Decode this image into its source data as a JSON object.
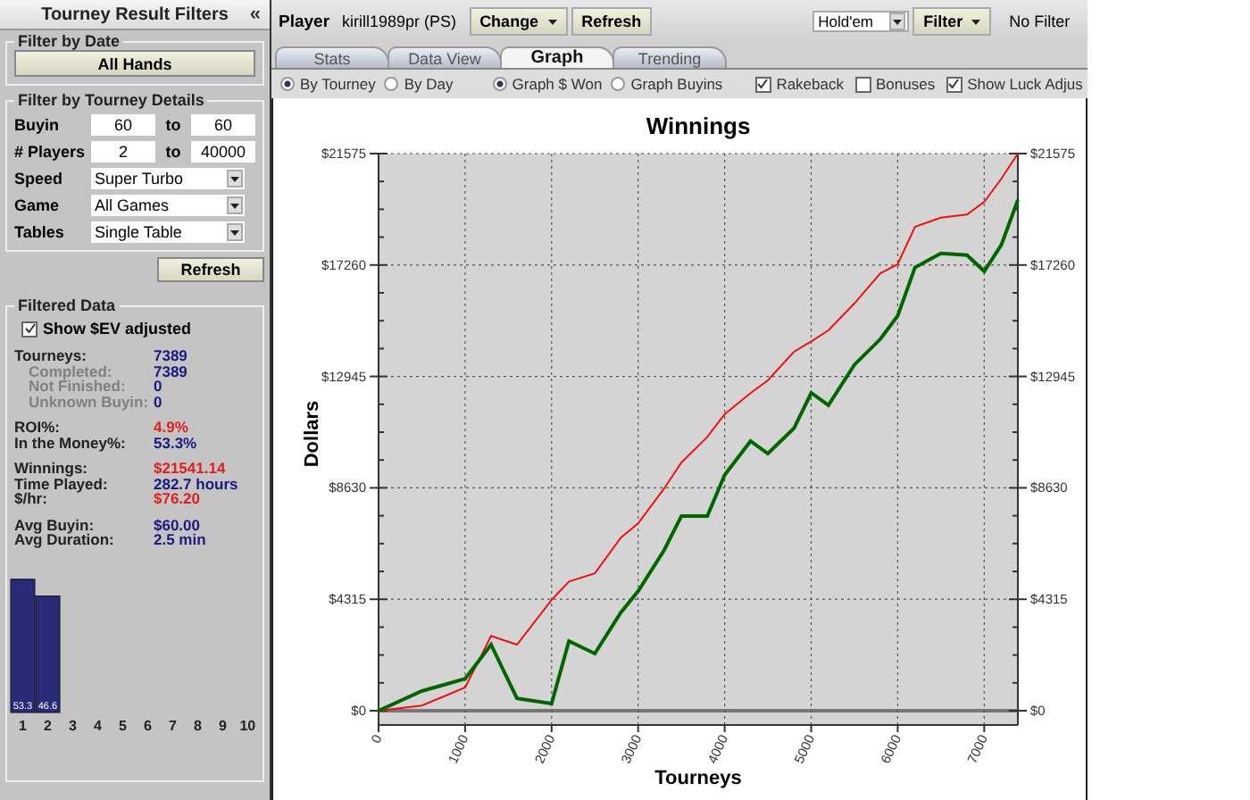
{
  "sidebar": {
    "title": "Tourney Result Filters",
    "collapse_glyph": "«",
    "date_filter": {
      "legend": "Filter by Date",
      "button": "All Hands"
    },
    "details": {
      "legend": "Filter by Tourney Details",
      "ranges": [
        {
          "label": "Buyin",
          "from": "60",
          "sep": "to",
          "to": "60"
        },
        {
          "label": "# Players",
          "from": "2",
          "sep": "to",
          "to": "40000"
        }
      ],
      "selects": [
        {
          "label": "Speed",
          "value": "Super Turbo"
        },
        {
          "label": "Game",
          "value": "All Games"
        },
        {
          "label": "Tables",
          "value": "Single Table"
        }
      ],
      "refresh": "Refresh"
    },
    "filtered": {
      "legend": "Filtered Data",
      "ev_checkbox": {
        "label": "Show $EV adjusted",
        "checked": true
      },
      "groups": [
        [
          {
            "label": "Tourneys:",
            "value": "7389",
            "sub": false,
            "color": "#1a1a80"
          },
          {
            "label": "Completed:",
            "value": "7389",
            "sub": true,
            "color": "#1a1a80"
          },
          {
            "label": "Not Finished:",
            "value": "0",
            "sub": true,
            "color": "#1a1a80"
          },
          {
            "label": "Unknown Buyin:",
            "value": "0",
            "sub": true,
            "color": "#1a1a80"
          }
        ],
        [
          {
            "label": "ROI%:",
            "value": "4.9%",
            "sub": false,
            "color": "#e02020"
          },
          {
            "label": "In the Money%:",
            "value": "53.3%",
            "sub": false,
            "color": "#1a1a80"
          }
        ],
        [
          {
            "label": "Winnings:",
            "value": "$21541.14",
            "sub": false,
            "color": "#e02020"
          },
          {
            "label": "Time Played:",
            "value": "282.7 hours",
            "sub": false,
            "color": "#1a1a80"
          },
          {
            "label": "$/hr:",
            "value": "$76.20",
            "sub": false,
            "color": "#e02020"
          }
        ],
        [
          {
            "label": "Avg Buyin:",
            "value": "$60.00",
            "sub": false,
            "color": "#1a1a80"
          },
          {
            "label": "Avg Duration:",
            "value": "2.5 min",
            "sub": false,
            "color": "#1a1a80"
          }
        ]
      ],
      "histogram": {
        "chart_data": {
          "type": "bar",
          "categories": [
            "1",
            "2",
            "3",
            "4",
            "5",
            "6",
            "7",
            "8",
            "9",
            "10"
          ],
          "values": [
            53.3,
            46.6,
            0,
            0,
            0,
            0,
            0,
            0,
            0,
            0
          ],
          "data_labels": true,
          "value_labels": [
            "53.3",
            "46.6",
            null,
            null,
            null,
            null,
            null,
            null,
            null,
            null
          ]
        }
      }
    }
  },
  "toolbar": {
    "player_label": "Player",
    "player": "kirill1989pr (PS)",
    "buttons": [
      {
        "label": "Change",
        "dropdown": true
      },
      {
        "label": "Refresh",
        "dropdown": false
      }
    ],
    "game_select": "Hold'em",
    "filter_button": {
      "label": "Filter",
      "dropdown": true
    },
    "filter_status": "No Filter"
  },
  "tabs": [
    {
      "label": "Stats",
      "selected": false
    },
    {
      "label": "Data View",
      "selected": false
    },
    {
      "label": "Graph",
      "selected": true
    },
    {
      "label": "Trending",
      "selected": false
    }
  ],
  "options": {
    "radio_groups": [
      [
        {
          "label": "By Tourney",
          "selected": true
        },
        {
          "label": "By Day",
          "selected": false
        }
      ],
      [
        {
          "label": "Graph $ Won",
          "selected": true
        },
        {
          "label": "Graph Buyins",
          "selected": false
        }
      ]
    ],
    "checkboxes": [
      {
        "label": "Rakeback",
        "checked": true
      },
      {
        "label": "Bonuses",
        "checked": false
      },
      {
        "label": "Show Luck Adjus",
        "checked": true
      }
    ]
  },
  "chart": {
    "chart_data": {
      "type": "line",
      "title": "Winnings",
      "xlabel": "Tourneys",
      "ylabel": "Dollars",
      "x": [
        0,
        500,
        1000,
        1300,
        1600,
        2000,
        2200,
        2500,
        2800,
        3000,
        3300,
        3500,
        3800,
        4000,
        4300,
        4500,
        4800,
        5000,
        5200,
        5500,
        5800,
        6000,
        6200,
        6500,
        6800,
        7000,
        7200,
        7389
      ],
      "series": [
        {
          "color": "#ee1111",
          "values": [
            0,
            200,
            900,
            2900,
            2560,
            4290,
            5000,
            5320,
            6700,
            7260,
            8600,
            9610,
            10600,
            11480,
            12300,
            12790,
            13900,
            14300,
            14730,
            15770,
            16940,
            17290,
            18740,
            19090,
            19220,
            19710,
            20610,
            21575
          ]
        },
        {
          "color": "#006600",
          "values": [
            0,
            760,
            1240,
            2560,
            480,
            280,
            2700,
            2210,
            3800,
            4630,
            6220,
            7540,
            7540,
            9130,
            10440,
            9960,
            10930,
            12310,
            11830,
            13400,
            14390,
            15290,
            17160,
            17710,
            17640,
            17020,
            18050,
            19780
          ]
        }
      ],
      "xlim": [
        0,
        7389
      ],
      "ylim": [
        0,
        21575
      ],
      "grid": true,
      "xticks": [
        {
          "value": 0,
          "label": "0"
        },
        {
          "value": 1000,
          "label": "1000"
        },
        {
          "value": 2000,
          "label": "2000"
        },
        {
          "value": 3000,
          "label": "3000"
        },
        {
          "value": 4000,
          "label": "4000"
        },
        {
          "value": 5000,
          "label": "5000"
        },
        {
          "value": 6000,
          "label": "6000"
        },
        {
          "value": 7000,
          "label": "7000"
        }
      ],
      "yticks": [
        {
          "value": 0,
          "label": "$0"
        },
        {
          "value": 4315,
          "label": "$4315"
        },
        {
          "value": 8630,
          "label": "$8630"
        },
        {
          "value": 12945,
          "label": "$12945"
        },
        {
          "value": 17260,
          "label": "$17260"
        },
        {
          "value": 21575,
          "label": "$21575"
        }
      ]
    },
    "right_axis_labels": [
      "$21575",
      "$17260",
      "$12945",
      "$8630",
      "$4315",
      "$0"
    ]
  }
}
